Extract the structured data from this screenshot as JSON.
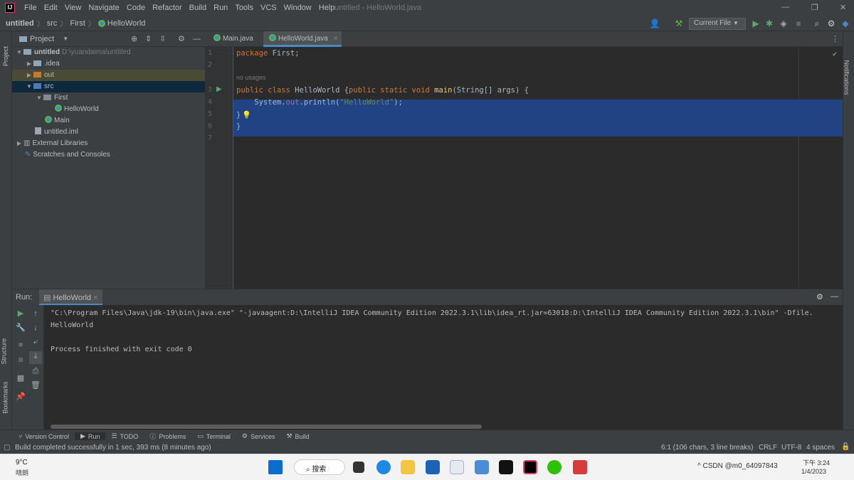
{
  "app": {
    "logo": "IJ",
    "window_title": "untitled - HelloWorld.java"
  },
  "menu": [
    "File",
    "Edit",
    "View",
    "Navigate",
    "Code",
    "Refactor",
    "Build",
    "Run",
    "Tools",
    "VCS",
    "Window",
    "Help"
  ],
  "breadcrumb": [
    "untitled",
    "src",
    "First",
    "HelloWorld"
  ],
  "toolbar": {
    "run_config": "Current File"
  },
  "side_labels": {
    "project": "Project",
    "structure": "Structure",
    "bookmarks": "Bookmarks",
    "notifications": "Notifications"
  },
  "project": {
    "header": "Project",
    "tree": [
      {
        "label": "untitled",
        "hint": "D:\\yuandaima\\untitled",
        "depth": 0,
        "expanded": true,
        "icon": "folder-icon"
      },
      {
        "label": ".idea",
        "depth": 1,
        "expanded": false,
        "icon": "folder-icon"
      },
      {
        "label": "out",
        "depth": 1,
        "expanded": false,
        "icon": "folder-orange-icon",
        "highlight": "#4b4a35"
      },
      {
        "label": "src",
        "depth": 1,
        "expanded": true,
        "icon": "folder-blue-icon",
        "selected": true
      },
      {
        "label": "First",
        "depth": 2,
        "expanded": true,
        "icon": "package-icon"
      },
      {
        "label": "HelloWorld",
        "depth": 3,
        "icon": "java-class-icon"
      },
      {
        "label": "Main",
        "depth": 2,
        "icon": "java-class-icon"
      },
      {
        "label": "untitled.iml",
        "depth": 1,
        "icon": "iml-file-icon"
      },
      {
        "label": "External Libraries",
        "depth": 0,
        "expanded": false,
        "icon": "libraries-icon"
      },
      {
        "label": "Scratches and Consoles",
        "depth": 0,
        "icon": "scratches-icon"
      }
    ]
  },
  "editor": {
    "tabs": [
      {
        "label": "Main.java",
        "active": false
      },
      {
        "label": "HelloWorld.java",
        "active": true
      }
    ],
    "line_numbers": [
      "1",
      "2",
      "3",
      "4",
      "5",
      "6",
      "7"
    ],
    "usage_hint": "no usages",
    "code": {
      "l1_kw": "package",
      "l1_rest": " First;",
      "l3_kw1": "public class",
      "l3_cls": " HelloWorld {",
      "l3_kw2": "public static void",
      "l3_sp": " ",
      "l3_fn": "main",
      "l3_args": "(String[] args) {",
      "l4_pre": "    System.",
      "l4_fld": "out",
      "l4_mid": ".println(",
      "l4_str": "\"HelloWorld\"",
      "l4_end": ");",
      "l5": "}",
      "l6": "}"
    }
  },
  "run": {
    "label": "Run:",
    "tab": "HelloWorld",
    "console": [
      "\"C:\\Program Files\\Java\\jdk-19\\bin\\java.exe\" \"-javaagent:D:\\IntelliJ IDEA Community Edition 2022.3.1\\lib\\idea_rt.jar=63018:D:\\IntelliJ IDEA Community Edition 2022.3.1\\bin\" -Dfile.",
      "HelloWorld",
      "",
      "Process finished with exit code 0"
    ]
  },
  "bottom_tools": [
    "Version Control",
    "Run",
    "TODO",
    "Problems",
    "Terminal",
    "Services",
    "Build"
  ],
  "status": {
    "message": "Build completed successfully in 1 sec, 393 ms (8 minutes ago)",
    "position": "6:1 (106 chars, 3 line breaks)",
    "line_sep": "CRLF",
    "encoding": "UTF-8",
    "indent": "4 spaces"
  },
  "taskbar": {
    "temp": "9°C",
    "weather": "晴朗",
    "search": "搜索",
    "time": "下午 3:24",
    "date": "1/4/2023",
    "tray": "^ CSDN @m0_64097843"
  },
  "colors": {
    "accent": "#4a88c7",
    "selection": "#214283",
    "keyword": "#cc7832"
  }
}
